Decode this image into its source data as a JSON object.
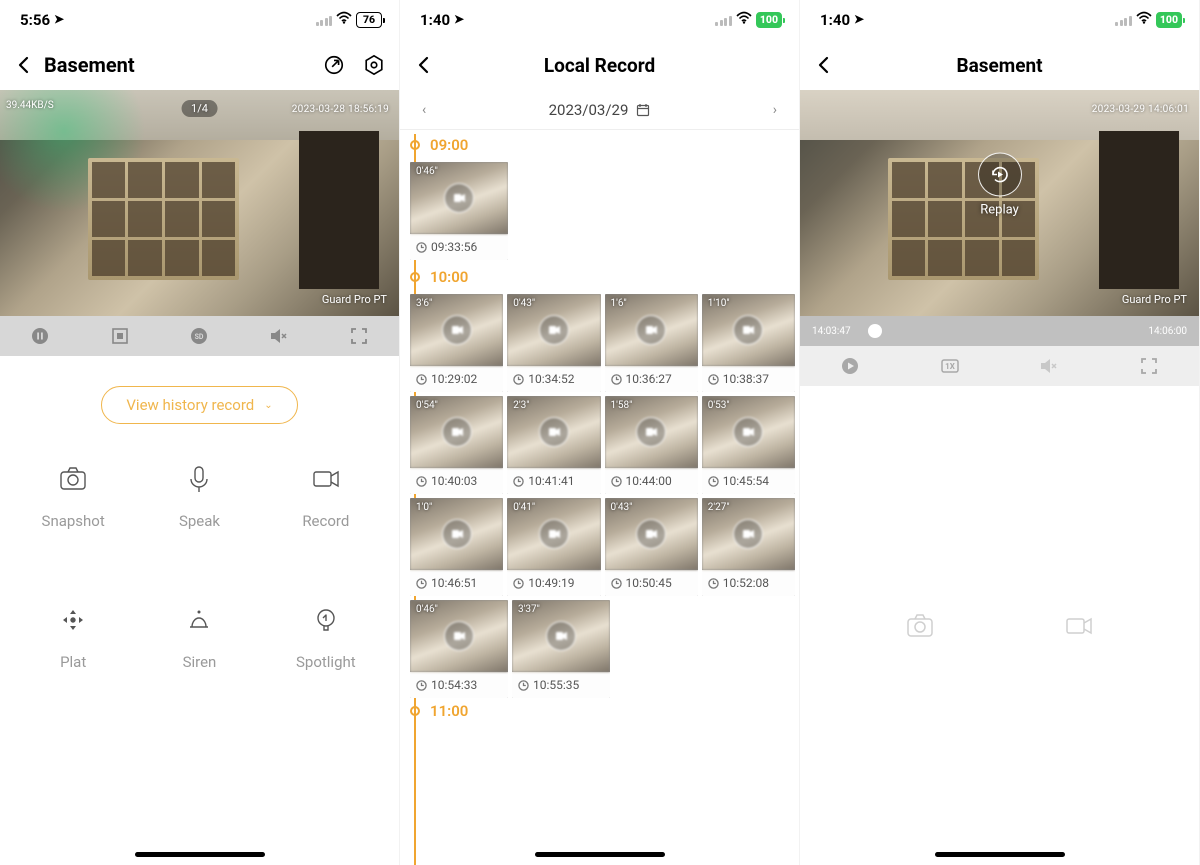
{
  "screens": {
    "left": {
      "status": {
        "time": "5:56",
        "battery": "76",
        "battery_style": "dark"
      },
      "title": "Basement",
      "video": {
        "kbs": "39.44KB/S",
        "page": "1/4",
        "ts": "2023-03-28 18:56:19",
        "watermark": "Guard Pro PT"
      },
      "history_label": "View history record",
      "actions": [
        "Snapshot",
        "Speak",
        "Record",
        "Plat",
        "Siren",
        "Spotlight"
      ]
    },
    "middle": {
      "status": {
        "time": "1:40",
        "battery": "100",
        "battery_style": "green"
      },
      "title": "Local Record",
      "date": "2023/03/29",
      "hours": {
        "h9": {
          "label": "09:00",
          "clips": [
            {
              "dur": "0'46\"",
              "time": "09:33:56"
            }
          ]
        },
        "h10": {
          "label": "10:00",
          "clips": [
            {
              "dur": "3'6\"",
              "time": "10:29:02"
            },
            {
              "dur": "0'43\"",
              "time": "10:34:52"
            },
            {
              "dur": "1'6\"",
              "time": "10:36:27"
            },
            {
              "dur": "1'10\"",
              "time": "10:38:37"
            },
            {
              "dur": "0'54\"",
              "time": "10:40:03"
            },
            {
              "dur": "2'3\"",
              "time": "10:41:41"
            },
            {
              "dur": "1'58\"",
              "time": "10:44:00"
            },
            {
              "dur": "0'53\"",
              "time": "10:45:54"
            },
            {
              "dur": "1'0\"",
              "time": "10:46:51"
            },
            {
              "dur": "0'41\"",
              "time": "10:49:19"
            },
            {
              "dur": "0'43\"",
              "time": "10:50:45"
            },
            {
              "dur": "2'27\"",
              "time": "10:52:08"
            },
            {
              "dur": "0'46\"",
              "time": "10:54:33"
            },
            {
              "dur": "3'37\"",
              "time": "10:55:35"
            }
          ]
        },
        "h11": {
          "label": "11:00"
        }
      }
    },
    "right": {
      "status": {
        "time": "1:40",
        "battery": "100",
        "battery_style": "green"
      },
      "title": "Basement",
      "video": {
        "ts": "2023-03-29 14:06:01",
        "watermark": "Guard Pro PT"
      },
      "replay_label": "Replay",
      "scrub": {
        "left": "14:03:47",
        "right": "14:06:00"
      }
    }
  }
}
